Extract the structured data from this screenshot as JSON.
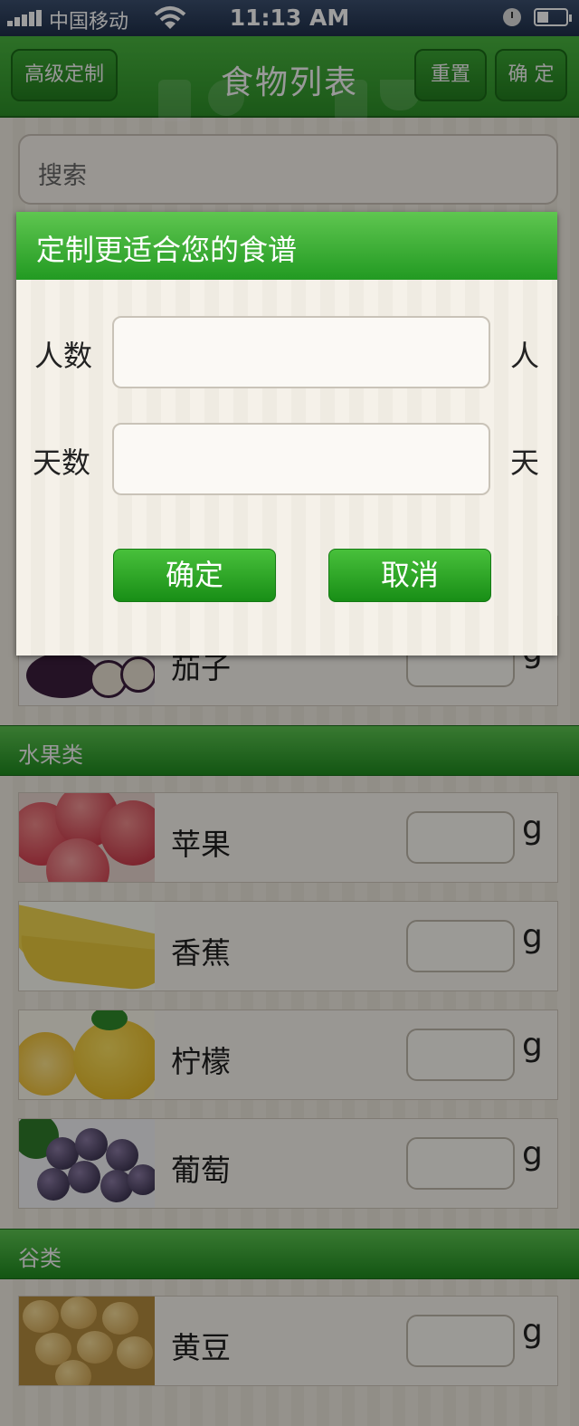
{
  "status_bar": {
    "carrier": "中国移动",
    "time": "11:13 AM"
  },
  "nav": {
    "left_button": "高级定制",
    "title": "食物列表",
    "reset_button": "重置",
    "confirm_button": "确 定"
  },
  "search": {
    "placeholder": "搜索"
  },
  "partial_row": {
    "name": "茄子",
    "unit": "g"
  },
  "categories": [
    {
      "label": "水果类",
      "items": [
        {
          "name": "苹果",
          "unit": "g"
        },
        {
          "name": "香蕉",
          "unit": "g"
        },
        {
          "name": "柠檬",
          "unit": "g"
        },
        {
          "name": "葡萄",
          "unit": "g"
        }
      ]
    },
    {
      "label": "谷类",
      "items": [
        {
          "name": "黄豆",
          "unit": "g"
        }
      ]
    }
  ],
  "dialog": {
    "title": "定制更适合您的食谱",
    "people_label": "人数",
    "people_unit": "人",
    "people_value": "",
    "days_label": "天数",
    "days_unit": "天",
    "days_value": "",
    "confirm": "确定",
    "cancel": "取消"
  }
}
